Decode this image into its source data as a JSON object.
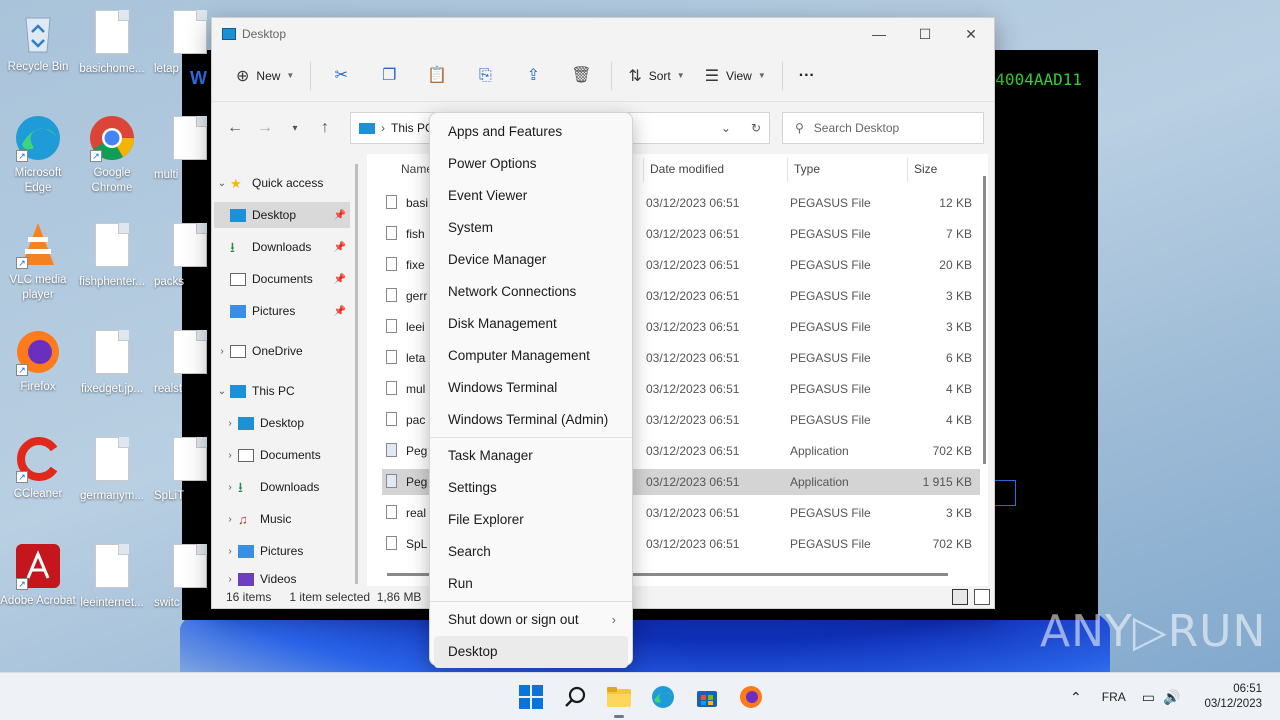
{
  "desktop": {
    "icons": [
      {
        "label": "Recycle Bin",
        "icon": "recycle-bin-icon"
      },
      {
        "label": "Microsoft Edge",
        "icon": "edge-icon"
      },
      {
        "label": "VLC media player",
        "icon": "vlc-icon"
      },
      {
        "label": "Firefox",
        "icon": "firefox-icon"
      },
      {
        "label": "CCleaner",
        "icon": "ccleaner-icon"
      },
      {
        "label": "Adobe Acrobat",
        "icon": "acrobat-icon"
      },
      {
        "label": "basichome...",
        "icon": "file-icon"
      },
      {
        "label": "Google Chrome",
        "icon": "chrome-icon"
      },
      {
        "label": "fishphenter...",
        "icon": "file-icon"
      },
      {
        "label": "fixedget.jp...",
        "icon": "file-icon"
      },
      {
        "label": "germanym...",
        "icon": "file-icon"
      },
      {
        "label": "leeinternet...",
        "icon": "file-icon"
      },
      {
        "label": "letap",
        "icon": "file-icon"
      },
      {
        "label": "multi",
        "icon": "file-icon"
      },
      {
        "label": "packs",
        "icon": "file-icon"
      },
      {
        "label": "realst",
        "icon": "file-icon"
      },
      {
        "label": "SpLiT",
        "icon": "file-icon"
      },
      {
        "label": "switc",
        "icon": "file-icon"
      }
    ],
    "bg_window_text_left": "W",
    "bg_window_text_right": "4004AAD11"
  },
  "explorer": {
    "title": "Desktop",
    "toolbar": {
      "new_label": "New",
      "sort_label": "Sort",
      "view_label": "View",
      "more_label": "···"
    },
    "address": {
      "crumb": "This PC",
      "search_placeholder": "Search Desktop"
    },
    "sidebar": [
      {
        "label": "Quick access",
        "icon": "star-icon"
      },
      {
        "label": "Desktop",
        "icon": "desktop-folder-icon"
      },
      {
        "label": "Downloads",
        "icon": "download-icon"
      },
      {
        "label": "Documents",
        "icon": "documents-icon"
      },
      {
        "label": "Pictures",
        "icon": "pictures-icon"
      },
      {
        "label": "OneDrive",
        "icon": "onedrive-icon"
      },
      {
        "label": "This PC",
        "icon": "pc-icon"
      },
      {
        "label": "Desktop",
        "icon": "desktop-folder-icon"
      },
      {
        "label": "Documents",
        "icon": "documents-icon"
      },
      {
        "label": "Downloads",
        "icon": "download-icon"
      },
      {
        "label": "Music",
        "icon": "music-icon"
      },
      {
        "label": "Pictures",
        "icon": "pictures-icon"
      },
      {
        "label": "Videos",
        "icon": "videos-icon"
      }
    ],
    "columns": {
      "name": "Name",
      "date": "Date modified",
      "type": "Type",
      "size": "Size"
    },
    "rows": [
      {
        "name": "basi",
        "date": "03/12/2023 06:51",
        "type": "PEGASUS File",
        "size": "12 KB"
      },
      {
        "name": "fish",
        "date": "03/12/2023 06:51",
        "type": "PEGASUS File",
        "size": "7 KB"
      },
      {
        "name": "fixe",
        "date": "03/12/2023 06:51",
        "type": "PEGASUS File",
        "size": "20 KB"
      },
      {
        "name": "gerr",
        "date": "03/12/2023 06:51",
        "type": "PEGASUS File",
        "size": "3 KB"
      },
      {
        "name": "leei",
        "date": "03/12/2023 06:51",
        "type": "PEGASUS File",
        "size": "3 KB"
      },
      {
        "name": "leta",
        "date": "03/12/2023 06:51",
        "type": "PEGASUS File",
        "size": "6 KB"
      },
      {
        "name": "mul",
        "date": "03/12/2023 06:51",
        "type": "PEGASUS File",
        "size": "4 KB"
      },
      {
        "name": "pac",
        "date": "03/12/2023 06:51",
        "type": "PEGASUS File",
        "size": "4 KB"
      },
      {
        "name": "Peg",
        "date": "03/12/2023 06:51",
        "type": "Application",
        "size": "702 KB"
      },
      {
        "name": "Peg",
        "date": "03/12/2023 06:51",
        "type": "Application",
        "size": "1 915 KB"
      },
      {
        "name": "real",
        "date": "03/12/2023 06:51",
        "type": "PEGASUS File",
        "size": "3 KB"
      },
      {
        "name": "SpL",
        "date": "03/12/2023 06:51",
        "type": "PEGASUS File",
        "size": "702 KB"
      }
    ],
    "status": {
      "count": "16 items",
      "selected": "1 item selected",
      "size": "1,86 MB"
    }
  },
  "context_menu": {
    "group1": [
      "Apps and Features",
      "Power Options",
      "Event Viewer",
      "System",
      "Device Manager",
      "Network Connections",
      "Disk Management",
      "Computer Management",
      "Windows Terminal",
      "Windows Terminal (Admin)"
    ],
    "group2": [
      "Task Manager",
      "Settings",
      "File Explorer",
      "Search",
      "Run"
    ],
    "group3": [
      "Shut down or sign out",
      "Desktop"
    ],
    "submenu_arrow": "›"
  },
  "watermark": "ANY▷RUN",
  "taskbar": {
    "lang": "FRA",
    "time": "06:51",
    "date": "03/12/2023"
  },
  "colors": {
    "accent": "#0067c0",
    "selection": "#d4d4d4"
  }
}
